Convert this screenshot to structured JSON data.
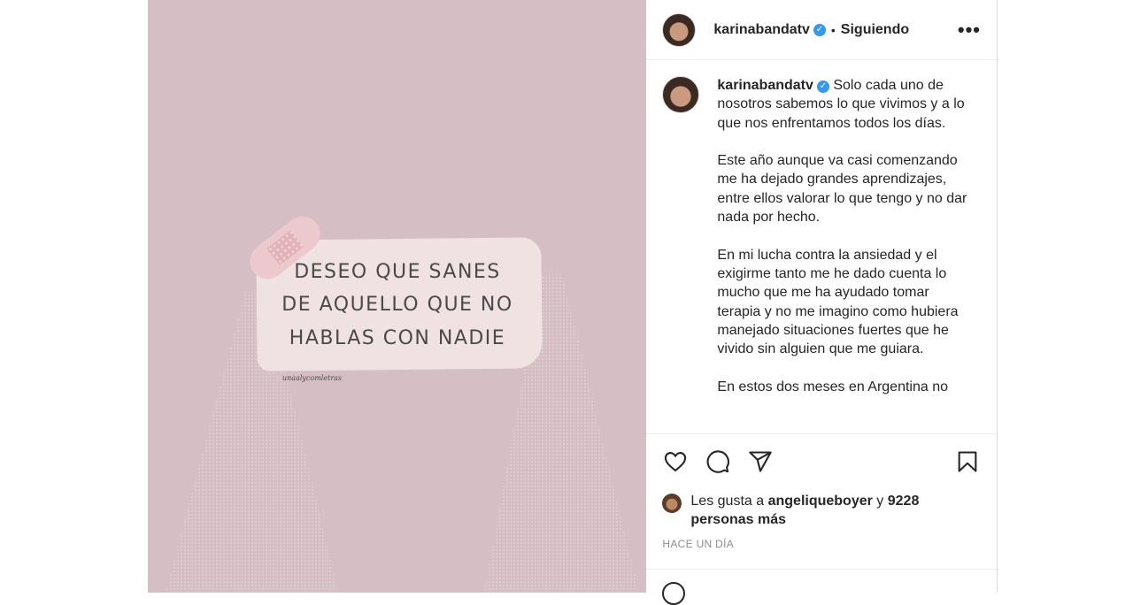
{
  "post": {
    "username": "karinabandatv",
    "follow_label": "Siguiendo",
    "image": {
      "quote_lines": [
        "DESEO QUE SANES",
        "DE AQUELLO QUE NO",
        "HABLAS CON NADIE"
      ],
      "signature": "unaalycomletras"
    },
    "caption": {
      "paragraphs": [
        "Solo cada uno de nosotros sabemos lo que vivimos y a lo que nos enfrentamos todos los días.",
        "Este año aunque va casi comenzando me ha dejado grandes aprendizajes, entre ellos valorar lo que tengo y no dar nada por hecho.",
        "En mi lucha contra la ansiedad y el exigirme tanto me he dado cuenta lo mucho que me ha ayudado tomar terapia y no me imagino como hubiera manejado situaciones fuertes que he vivido sin alguien que me guiara.",
        "En estos dos meses en Argentina no"
      ]
    },
    "likes": {
      "prefix": "Les gusta a",
      "user": "angeliqueboyer",
      "conjunction": "y",
      "count_text": "9228 personas más"
    },
    "timestamp": "HACE UN DÍA"
  },
  "colors": {
    "image_bg": "#d5bfc4",
    "verified": "#3897f0"
  },
  "icons": [
    "verified-icon",
    "more-options-icon",
    "heart-icon",
    "comment-icon",
    "share-icon",
    "bookmark-icon",
    "emoji-icon"
  ]
}
